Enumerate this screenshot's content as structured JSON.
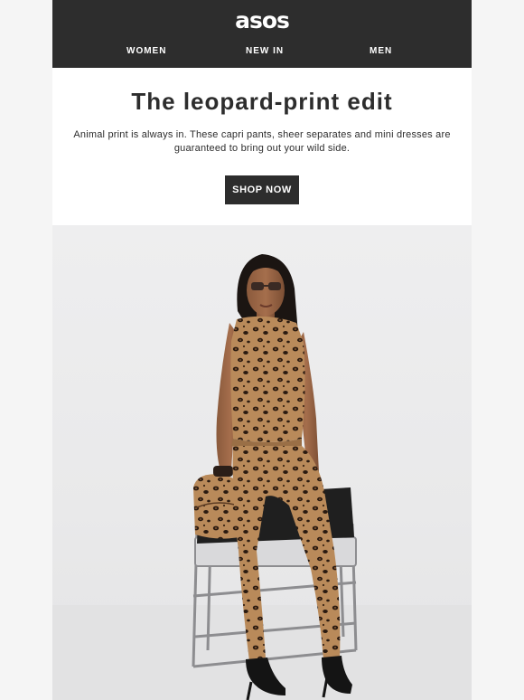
{
  "brand": {
    "logo_text": "asos"
  },
  "nav": {
    "items": [
      {
        "label": "WOMEN"
      },
      {
        "label": "NEW IN"
      },
      {
        "label": "MEN"
      }
    ]
  },
  "hero": {
    "title": "The leopard-print edit",
    "description": "Animal print is always in. These capri pants, sheer separates and mini dresses are guaranteed to bring out your wild side.",
    "cta_label": "SHOP NOW"
  },
  "colors": {
    "header_bg": "#2d2d2d",
    "page_bg": "#f5f5f5",
    "content_bg": "#ffffff",
    "text": "#2d2d2d",
    "button_bg": "#2d2d2d",
    "button_text": "#ffffff"
  }
}
